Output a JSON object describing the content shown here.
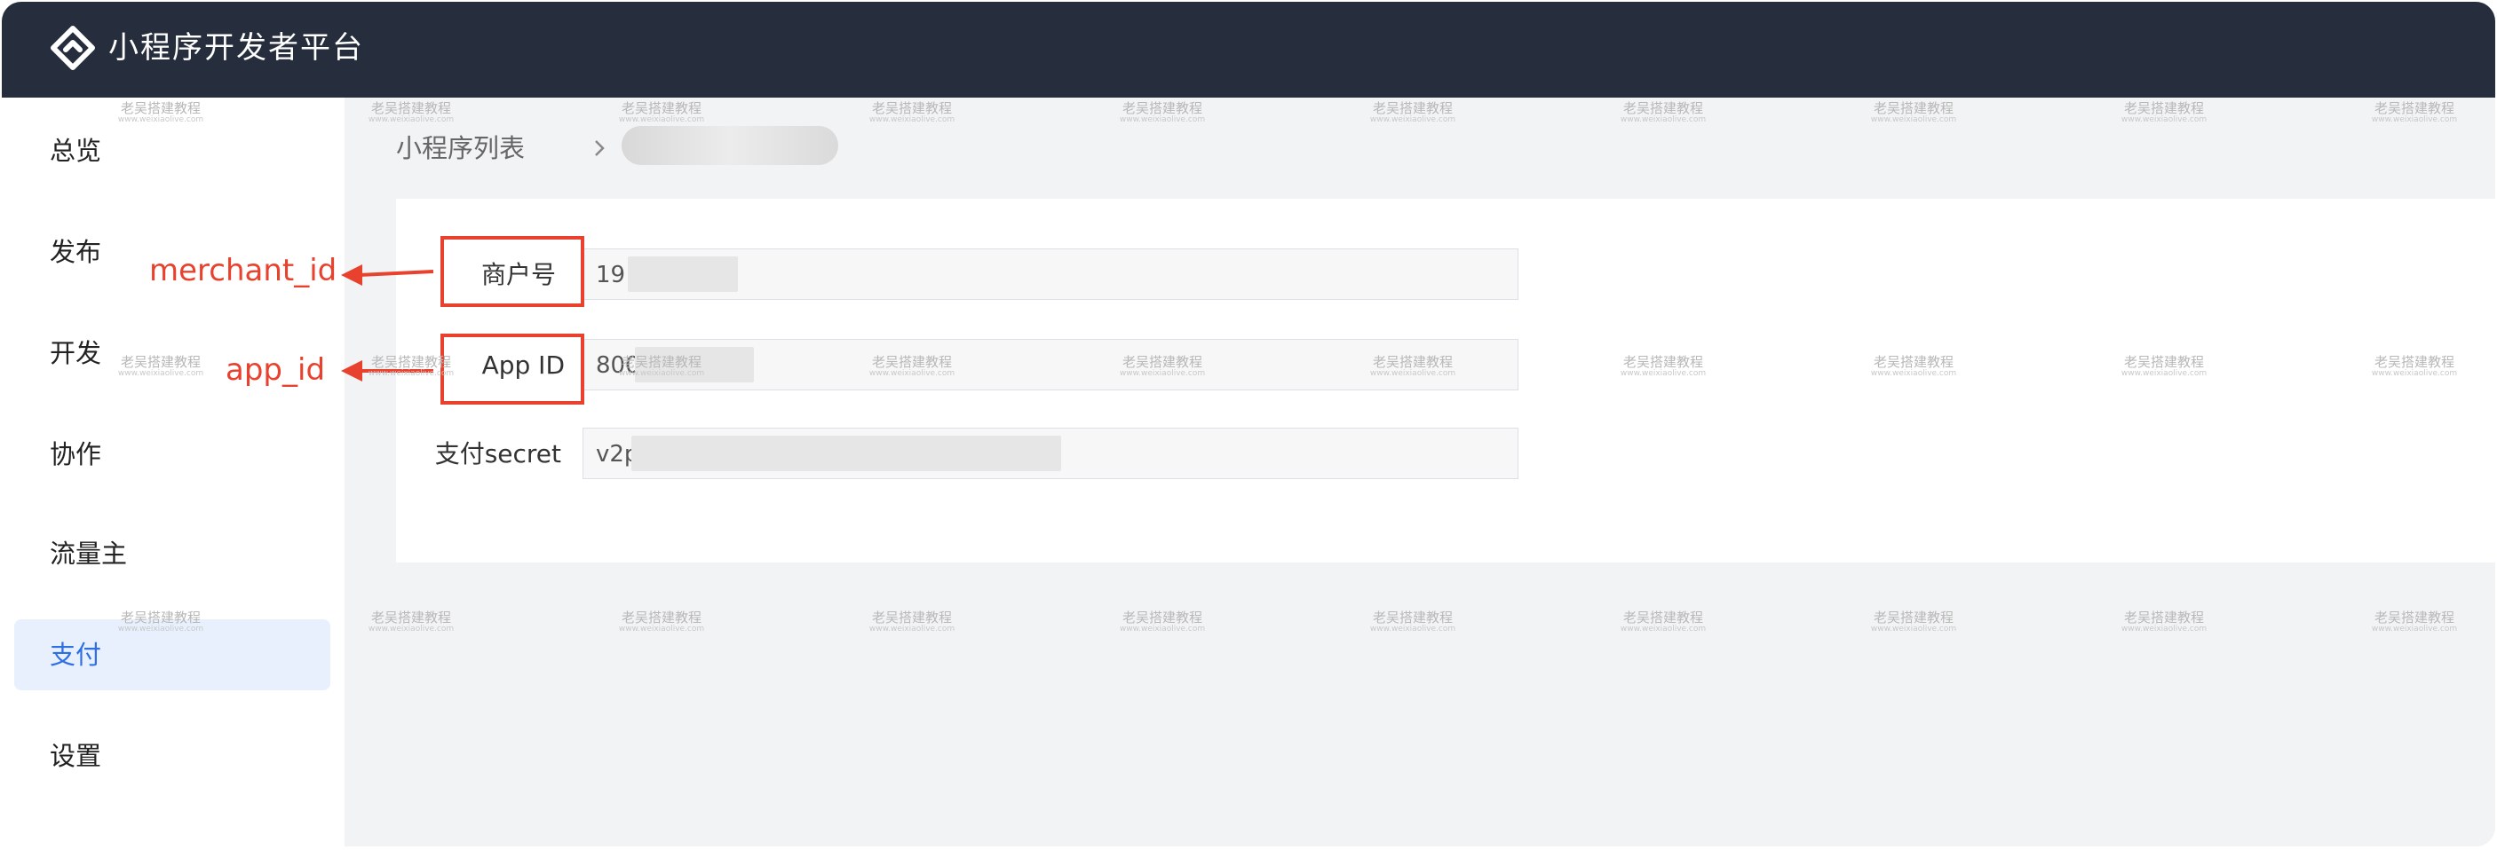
{
  "app": {
    "title": "小程序开发者平台",
    "logo_icon": "mini-program-logo-icon"
  },
  "sidebar": {
    "items": [
      {
        "label": "总览",
        "active": false
      },
      {
        "label": "发布",
        "active": false
      },
      {
        "label": "开发",
        "active": false
      },
      {
        "label": "协作",
        "active": false
      },
      {
        "label": "流量主",
        "active": false
      },
      {
        "label": "支付",
        "active": true
      },
      {
        "label": "设置",
        "active": false
      }
    ]
  },
  "breadcrumb": {
    "root": "小程序列表",
    "separator_icon": "chevron-right-icon"
  },
  "form": {
    "fields": [
      {
        "label": "商户号",
        "value_visible": "19",
        "masked": true
      },
      {
        "label": "App ID",
        "value_visible": "800",
        "masked": true
      },
      {
        "label": "支付secret",
        "value_visible": "v2p",
        "masked": true
      }
    ]
  },
  "annotations": {
    "merchant": "merchant_id",
    "app": "app_id",
    "color": "#e8412e"
  },
  "watermark": {
    "text": "老吴搭建教程",
    "url": "www.weixiaolive.com"
  },
  "colors": {
    "topbar": "#262d3c",
    "active_bg": "#e8f0fd",
    "active_text": "#2f6fe4",
    "annotation": "#e8412e"
  }
}
